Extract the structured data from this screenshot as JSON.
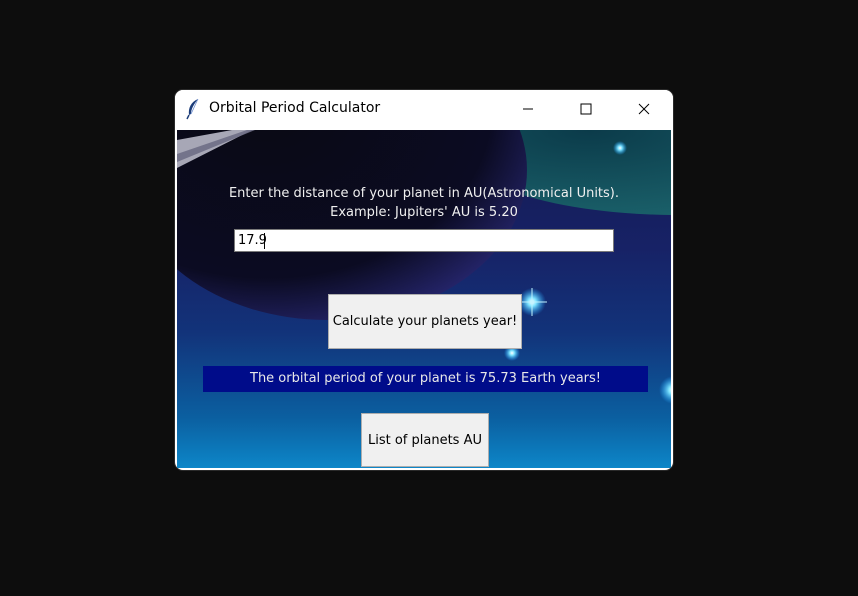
{
  "window": {
    "title": "Orbital Period Calculator",
    "icon": "feather-icon",
    "controls": [
      "minimize-icon",
      "maximize-icon",
      "close-icon"
    ]
  },
  "form": {
    "prompt_line1": "Enter the distance of your planet in AU(Astronomical Units).",
    "prompt_line2": "Example: Jupiters' AU is 5.20",
    "input_value": "17.9",
    "calculate_label": "Calculate your planets year!",
    "result_text": "The orbital period of your planet is 75.73 Earth years!",
    "list_label": "List of planets AU"
  },
  "colors": {
    "result_background": "#000c8a",
    "window_background_top": "#141a52",
    "window_background_bottom": "#0d86c8"
  }
}
